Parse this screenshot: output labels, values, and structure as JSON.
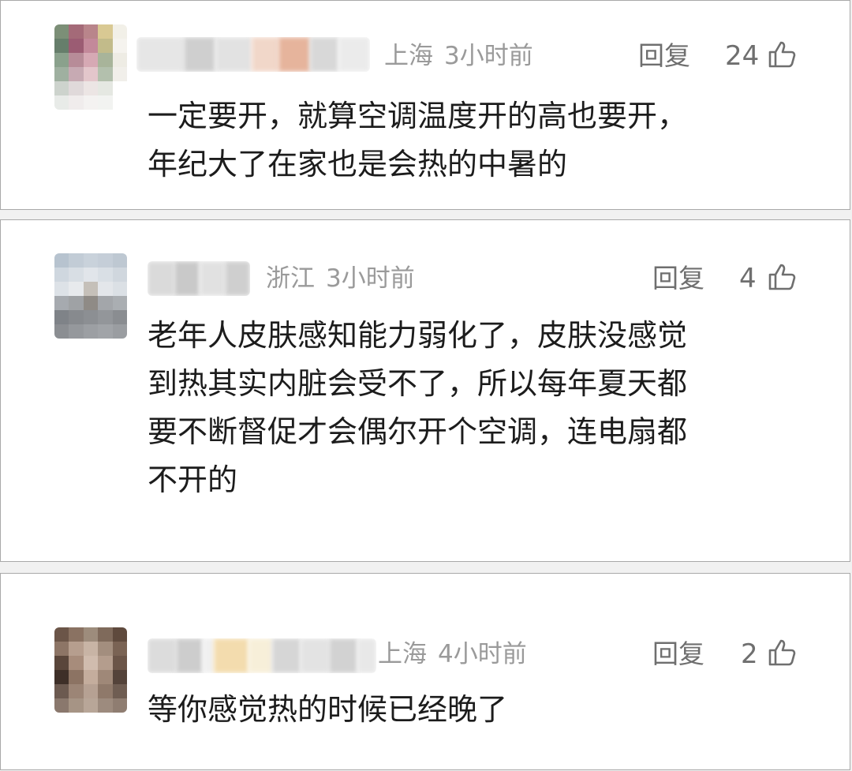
{
  "comments": [
    {
      "location": "上海",
      "time": "3小时前",
      "reply_label": "回复",
      "likes": "24",
      "content_lines": [
        "一定要开，就算空调温度开的高也要开，",
        "年纪大了在家也是会热的中暑的"
      ]
    },
    {
      "location": "浙江",
      "time": "3小时前",
      "reply_label": "回复",
      "likes": "4",
      "content_lines": [
        "老年人皮肤感知能力弱化了，皮肤没感觉",
        "到热其实内脏会受不了，所以每年夏天都",
        "要不断督促才会偶尔开个空调，连电扇都",
        "不开的"
      ]
    },
    {
      "location": "上海",
      "time": "4小时前",
      "reply_label": "回复",
      "likes": "2",
      "content_lines": [
        "等你感觉热的时候已经晚了"
      ]
    }
  ],
  "icons": {
    "like": "thumbs-up-icon",
    "avatar": "pixelated-avatar",
    "username": "blurred-username"
  },
  "colors": {
    "text_primary": "#1c1c1c",
    "text_meta": "#9a9a9a",
    "text_action": "#6f6f6f",
    "card_border": "#a9a9a9",
    "background": "#f1f1f1"
  }
}
